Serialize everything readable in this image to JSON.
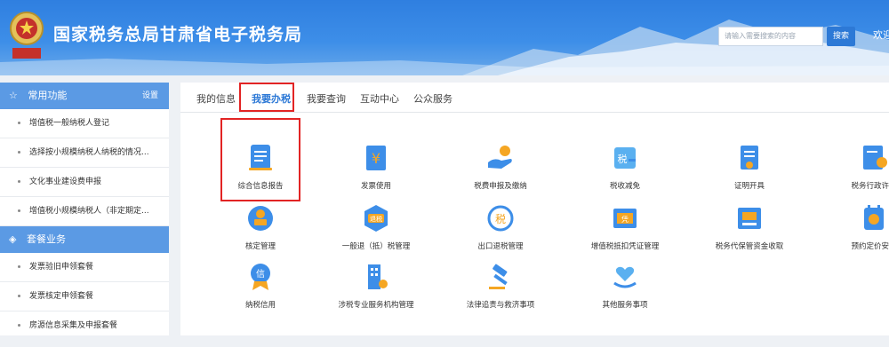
{
  "header": {
    "emblem_text": "中国税务",
    "title": "国家税务总局甘肃省电子税务局",
    "search_placeholder": "请输入需要搜索的内容",
    "search_button": "搜索",
    "welcome": "欢迎"
  },
  "sidebar": {
    "common_title": "常用功能",
    "setting": "设置",
    "common_items": [
      "增值税一般纳税人登记",
      "选择按小规模纳税人纳税的情况...",
      "文化事业建设费申报",
      "增值税小规模纳税人（非定期定..."
    ],
    "package_title": "套餐业务",
    "package_items": [
      "发票验旧申领套餐",
      "发票核定申领套餐",
      "房源信息采集及申报套餐"
    ]
  },
  "tabs": [
    "我的信息",
    "我要办税",
    "我要查询",
    "互动中心",
    "公众服务"
  ],
  "active_tab": "我要办税",
  "services": [
    {
      "label": "综合信息报告",
      "icon": "document-report-icon"
    },
    {
      "label": "发票使用",
      "icon": "invoice-yen-icon"
    },
    {
      "label": "税费申报及缴纳",
      "icon": "hand-coin-icon"
    },
    {
      "label": "税收减免",
      "icon": "tax-reduction-icon"
    },
    {
      "label": "证明开具",
      "icon": "certificate-icon"
    },
    {
      "label": "税务行政许可",
      "icon": "admin-license-icon"
    },
    {
      "label": "核定管理",
      "icon": "stamp-icon"
    },
    {
      "label": "一般退（抵）税管理",
      "icon": "tax-refund-icon"
    },
    {
      "label": "出口退税管理",
      "icon": "export-refund-icon"
    },
    {
      "label": "增值税抵扣凭证管理",
      "icon": "vat-voucher-icon"
    },
    {
      "label": "税务代保管资金收取",
      "icon": "custody-fund-icon"
    },
    {
      "label": "预约定价安排",
      "icon": "pricing-agreement-icon"
    },
    {
      "label": "纳税信用",
      "icon": "credit-medal-icon"
    },
    {
      "label": "涉税专业服务机构管理",
      "icon": "building-icon"
    },
    {
      "label": "法律追责与救济事项",
      "icon": "gavel-icon"
    },
    {
      "label": "其他服务事项",
      "icon": "heart-hand-icon"
    }
  ],
  "colors": {
    "header_blue": "#3d8ee8",
    "accent_blue": "#2d79d6",
    "sidebar_blue": "#5b9ae4",
    "highlight_red": "#e22424",
    "icon_orange": "#f5a623"
  }
}
